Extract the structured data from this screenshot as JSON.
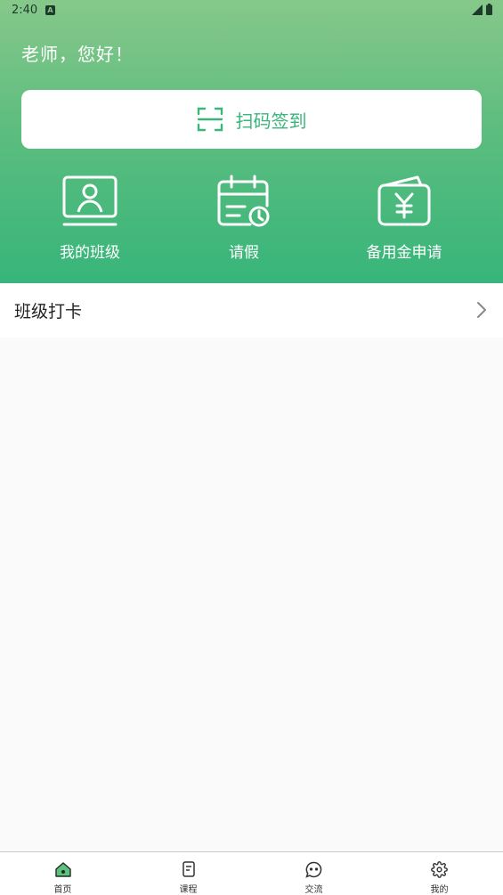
{
  "status": {
    "time": "2:40"
  },
  "header": {
    "greeting": "老师，您好！",
    "scan_label": "扫码签到"
  },
  "quick_actions": [
    {
      "label": "我的班级",
      "icon": "class-card-icon"
    },
    {
      "label": "请假",
      "icon": "calendar-clock-icon"
    },
    {
      "label": "备用金申请",
      "icon": "wallet-yen-icon"
    }
  ],
  "list": {
    "item_label": "班级打卡"
  },
  "tabs": [
    {
      "label": "首页",
      "icon": "home-icon",
      "active": true
    },
    {
      "label": "课程",
      "icon": "document-icon",
      "active": false
    },
    {
      "label": "交流",
      "icon": "chat-icon",
      "active": false
    },
    {
      "label": "我的",
      "icon": "gear-icon",
      "active": false
    }
  ],
  "colors": {
    "accent": "#3ab57b",
    "header_top": "#86c88a",
    "header_bottom": "#37b57a"
  }
}
